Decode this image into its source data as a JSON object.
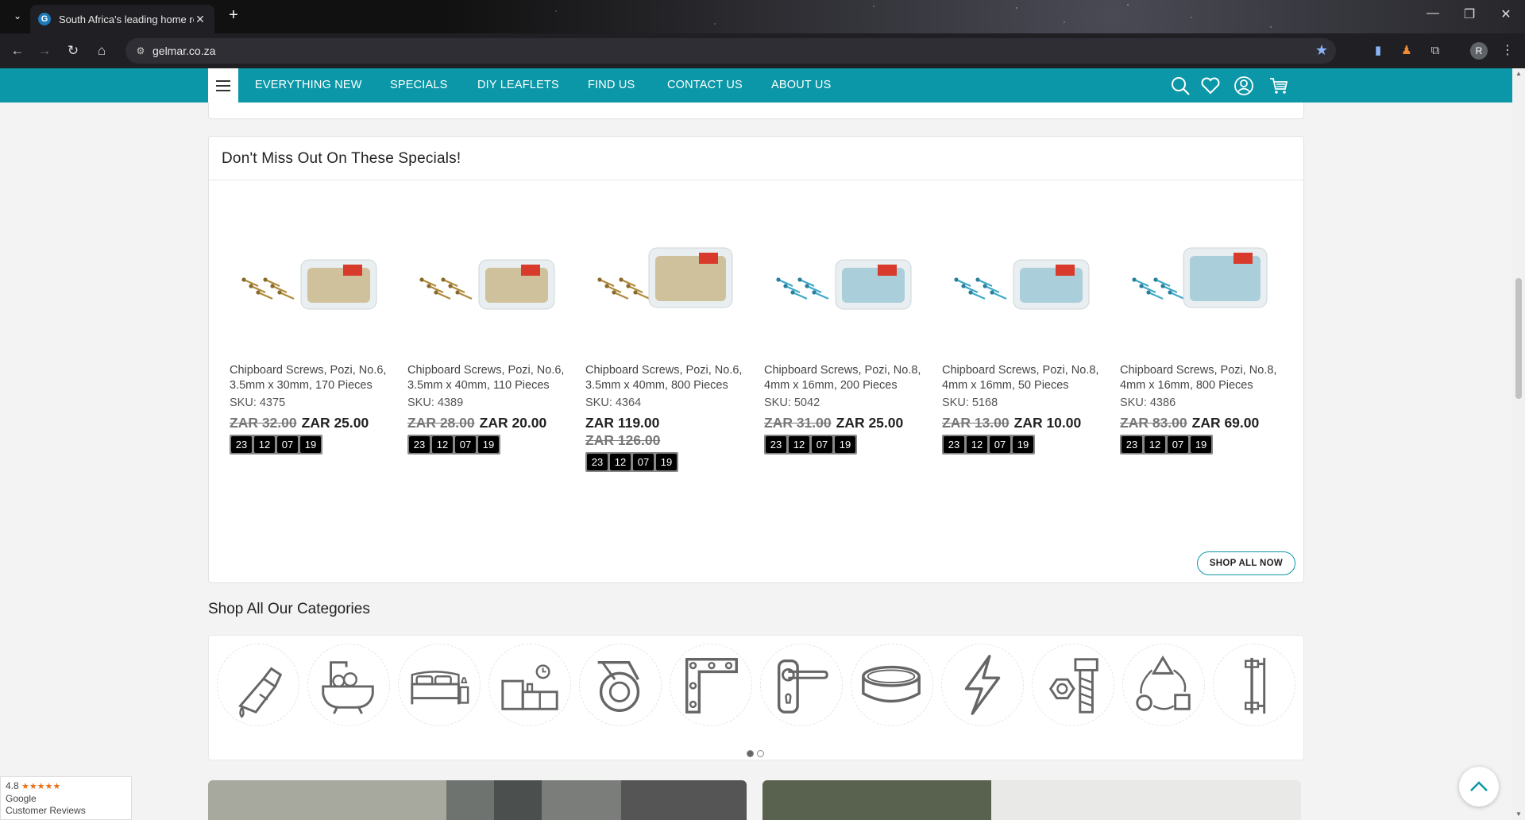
{
  "browser": {
    "tab_title": "South Africa's leading home re",
    "favicon_letter": "G",
    "url": "gelmar.co.za",
    "profile_initial": "R",
    "new_tab": "+",
    "close": "✕"
  },
  "nav": {
    "links": [
      "EVERYTHING NEW",
      "SPECIALS",
      "DIY LEAFLETS",
      "FIND US",
      "CONTACT US",
      "ABOUT US"
    ]
  },
  "specials": {
    "heading": "Don't Miss Out On These Specials!",
    "shop_all": "SHOP ALL NOW",
    "products": [
      {
        "name": "Chipboard Screws, Pozi, No.6, 3.5mm x 30mm, 170 Pieces",
        "sku": "SKU:  4375",
        "old_price": "ZAR 32.00",
        "price": "ZAR 25.00",
        "countdown": [
          "23",
          "12",
          "07",
          "19"
        ],
        "screw_color": "brass"
      },
      {
        "name": "Chipboard Screws, Pozi, No.6, 3.5mm x 40mm, 110 Pieces",
        "sku": "SKU:  4389",
        "old_price": "ZAR 28.00",
        "price": "ZAR 20.00",
        "countdown": [
          "23",
          "12",
          "07",
          "19"
        ],
        "screw_color": "brass"
      },
      {
        "name": "Chipboard Screws, Pozi, No.6, 3.5mm x 40mm, 800 Pieces",
        "sku": "SKU:  4364",
        "old_price": "ZAR 126.00",
        "price": "ZAR 119.00",
        "countdown": [
          "23",
          "12",
          "07",
          "19"
        ],
        "screw_color": "brass"
      },
      {
        "name": "Chipboard Screws, Pozi, No.8, 4mm x 16mm, 200 Pieces",
        "sku": "SKU:  5042",
        "old_price": "ZAR 31.00",
        "price": "ZAR 25.00",
        "countdown": [
          "23",
          "12",
          "07",
          "19"
        ],
        "screw_color": "blue"
      },
      {
        "name": "Chipboard Screws, Pozi, No.8, 4mm x 16mm, 50 Pieces",
        "sku": "SKU:  5168",
        "old_price": "ZAR 13.00",
        "price": "ZAR 10.00",
        "countdown": [
          "23",
          "12",
          "07",
          "19"
        ],
        "screw_color": "blue"
      },
      {
        "name": "Chipboard Screws, Pozi, No.8, 4mm x 16mm, 800 Pieces",
        "sku": "SKU:  4386",
        "old_price": "ZAR 83.00",
        "price": "ZAR 69.00",
        "countdown": [
          "23",
          "12",
          "07",
          "19"
        ],
        "screw_color": "blue"
      }
    ]
  },
  "categories": {
    "heading": "Shop All Our Categories",
    "icons": [
      "glue-icon",
      "bath-icon",
      "bed-icon",
      "kitchen-icon",
      "castor-wheel-icon",
      "corner-bracket-icon",
      "door-handle-icon",
      "ring-icon",
      "lightning-icon",
      "bolt-nut-icon",
      "shapes-icon",
      "rail-icon"
    ]
  },
  "reviews": {
    "rating": "4.8",
    "stars": "★★★★★",
    "source": "Google",
    "label": "Customer Reviews"
  },
  "colors": {
    "brand_teal": "#0b97a7",
    "icon_gray": "#666666"
  }
}
